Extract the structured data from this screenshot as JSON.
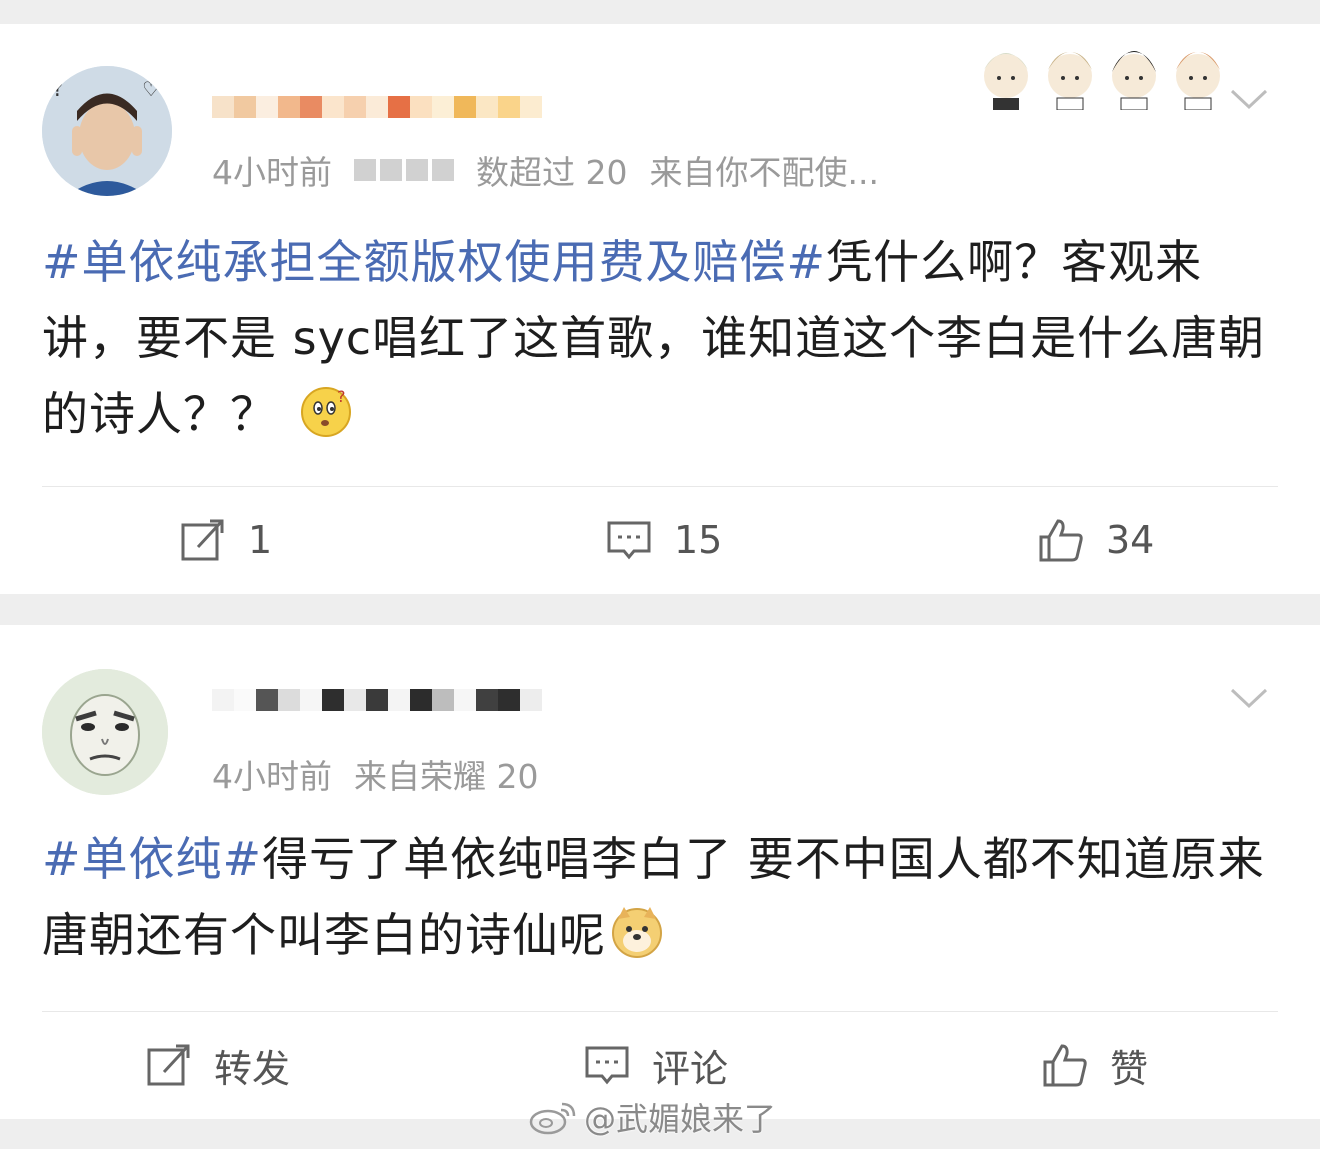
{
  "post1": {
    "meta_time": "4小时前",
    "meta_tail": "数超过 20",
    "meta_source": "来自你不配使...",
    "text": {
      "topic": "#单依纯承担全额版权使用费及赔偿#",
      "body": "凭什么啊？客观来讲，要不是 syc唱红了这首歌，谁知道这个李白是什么唐朝的诗人？？"
    },
    "emoji": "thinking-emoji",
    "actions": {
      "repost": "1",
      "comment": "15",
      "like": "34"
    }
  },
  "post2": {
    "meta_time": "4小时前",
    "meta_source": "来自荣耀 20",
    "text": {
      "topic": "#单依纯#",
      "body": "得亏了单依纯唱李白了 要不中国人都不知道原来唐朝还有个叫李白的诗仙呢"
    },
    "emoji": "doge-emoji",
    "actions": {
      "repost": "转发",
      "comment": "评论",
      "like": "赞"
    }
  },
  "watermark": {
    "text": "@武媚娘来了"
  },
  "colors": {
    "topic": "#4a6bb3",
    "meta": "#9a9a9a",
    "background": "#eeeeee"
  }
}
